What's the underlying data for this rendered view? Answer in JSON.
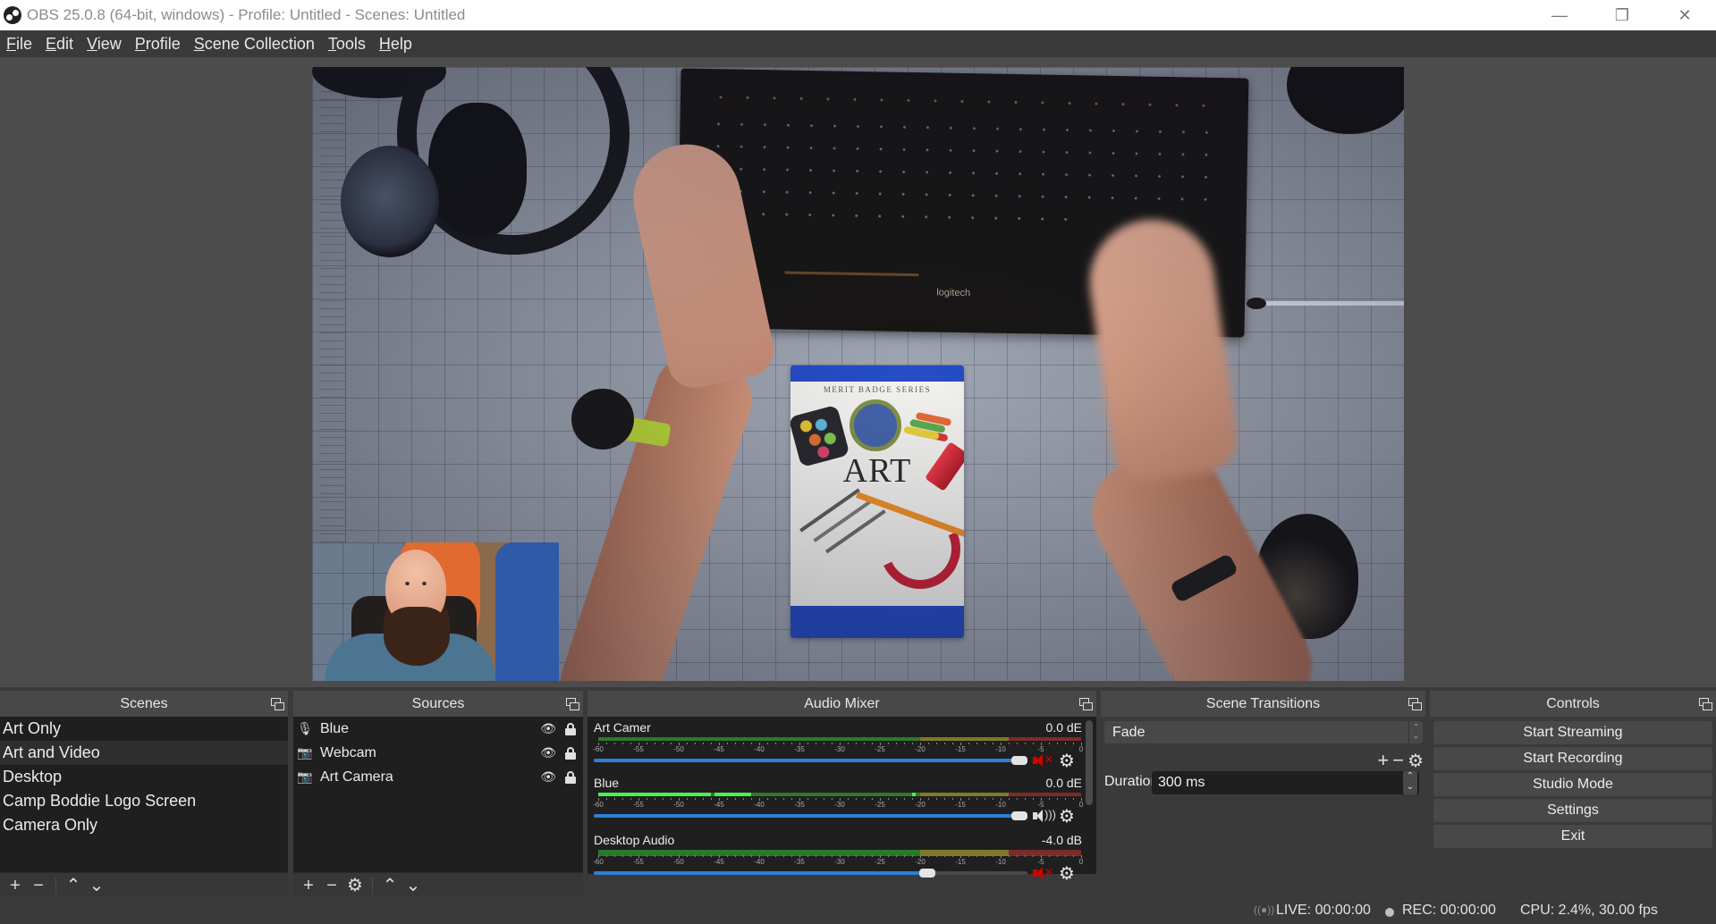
{
  "window": {
    "title": "OBS 25.0.8 (64-bit, windows) - Profile: Untitled - Scenes: Untitled",
    "controls": {
      "minimize": "minimize-icon",
      "maximize": "restore-icon",
      "close": "close-icon"
    }
  },
  "menu": [
    {
      "label": "File",
      "accel": "F",
      "rest": "ile"
    },
    {
      "label": "Edit",
      "accel": "E",
      "rest": "dit"
    },
    {
      "label": "View",
      "accel": "V",
      "rest": "iew"
    },
    {
      "label": "Profile",
      "accel": "P",
      "rest": "rofile"
    },
    {
      "label": "Scene Collection",
      "accel": "S",
      "rest": "cene Collection"
    },
    {
      "label": "Tools",
      "accel": "T",
      "rest": "ools"
    },
    {
      "label": "Help",
      "accel": "H",
      "rest": "elp"
    }
  ],
  "preview": {
    "book_series": "MERIT BADGE SERIES",
    "book_title": "ART",
    "keyboard_brand": "logitech"
  },
  "scenes": {
    "title": "Scenes",
    "items": [
      "Art Only",
      "Art and Video",
      "Desktop",
      "Camp Boddie Logo Screen",
      "Camera Only"
    ],
    "selected_index": 1,
    "toolbar": {
      "add": "+",
      "remove": "−",
      "up": "⌃",
      "down": "⌄"
    }
  },
  "sources": {
    "title": "Sources",
    "items": [
      {
        "name": "Blue",
        "type_icon": "microphone-icon",
        "visible": true,
        "locked": true
      },
      {
        "name": "Webcam",
        "type_icon": "camera-icon",
        "visible": true,
        "locked": true
      },
      {
        "name": "Art Camera",
        "type_icon": "camera-icon",
        "visible": true,
        "locked": true
      }
    ],
    "toolbar": {
      "add": "+",
      "remove": "−",
      "properties": "⚙",
      "up": "⌃",
      "down": "⌄"
    }
  },
  "mixer": {
    "title": "Audio Mixer",
    "scale_labels": [
      "-60",
      "-55",
      "-50",
      "-45",
      "-40",
      "-35",
      "-30",
      "-25",
      "-20",
      "-15",
      "-10",
      "-5",
      "0"
    ],
    "colors": {
      "green": "#2b7a2b",
      "yellow": "#7f7a2a",
      "red": "#7c2b2b",
      "active": "#4cf04c",
      "slider": "#2d80d6",
      "muted": "#d40000"
    },
    "tracks": [
      {
        "name": "Art Camer",
        "db": "0.0 dB",
        "db_shown": "0.0 dE",
        "volume_fraction": 1.0,
        "muted": true,
        "level_db": null,
        "channels": 1
      },
      {
        "name": "Blue",
        "db": "0.0 dB",
        "db_shown": "0.0 dE",
        "volume_fraction": 1.0,
        "muted": false,
        "level_db": -41,
        "peak_db": -21,
        "channels": 1
      },
      {
        "name": "Desktop Audio",
        "db": "-4.0 dB",
        "db_shown": "-4.0 dB",
        "volume_fraction": 0.78,
        "muted": true,
        "level_db": null,
        "channels": 2
      }
    ]
  },
  "transitions": {
    "title": "Scene Transitions",
    "selected": "Fade",
    "duration_label": "Duration",
    "duration_value": "300 ms"
  },
  "controls": {
    "title": "Controls",
    "buttons": [
      "Start Streaming",
      "Start Recording",
      "Studio Mode",
      "Settings",
      "Exit"
    ]
  },
  "status": {
    "live": "LIVE: 00:00:00",
    "rec": "REC: 00:00:00",
    "cpu": "CPU: 2.4%, 30.00 fps"
  }
}
